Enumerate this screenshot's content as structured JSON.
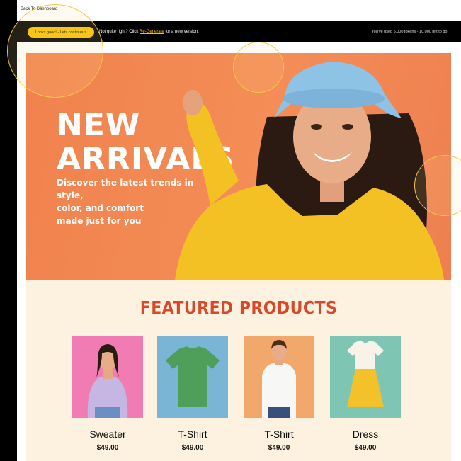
{
  "topbar": {
    "back_label": "Back To Dashboard"
  },
  "actionbar": {
    "continue_label": "Looks good! - Lets continue >",
    "prompt_text": "Not quite right? Click ",
    "regenerate_label": "Re-Generate",
    "prompt_suffix": " for a new version.",
    "tokens_text": "You've used 5,000 tokens - 10,000 left to go."
  },
  "hero": {
    "title_line1": "NEW",
    "title_line2": "ARRIVALS",
    "subtitle_line1": "Discover the latest trends in style,",
    "subtitle_line2": "color, and comfort",
    "subtitle_line3": "made just for you"
  },
  "featured": {
    "title": "FEATURED PRODUCTS",
    "products": [
      {
        "name": "Sweater",
        "price": "$49.00",
        "bg": "#f07cb3"
      },
      {
        "name": "T-Shirt",
        "price": "$49.00",
        "bg": "#7ab5d6"
      },
      {
        "name": "T-Shirt",
        "price": "$49.00",
        "bg": "#f1a86a"
      },
      {
        "name": "Dress",
        "price": "$49.00",
        "bg": "#7fc5b3"
      }
    ]
  },
  "colors": {
    "accent": "#f5c100",
    "hero_bg": "#f0824d",
    "featured_title": "#d8482a",
    "featured_bg": "#fdf2df"
  }
}
